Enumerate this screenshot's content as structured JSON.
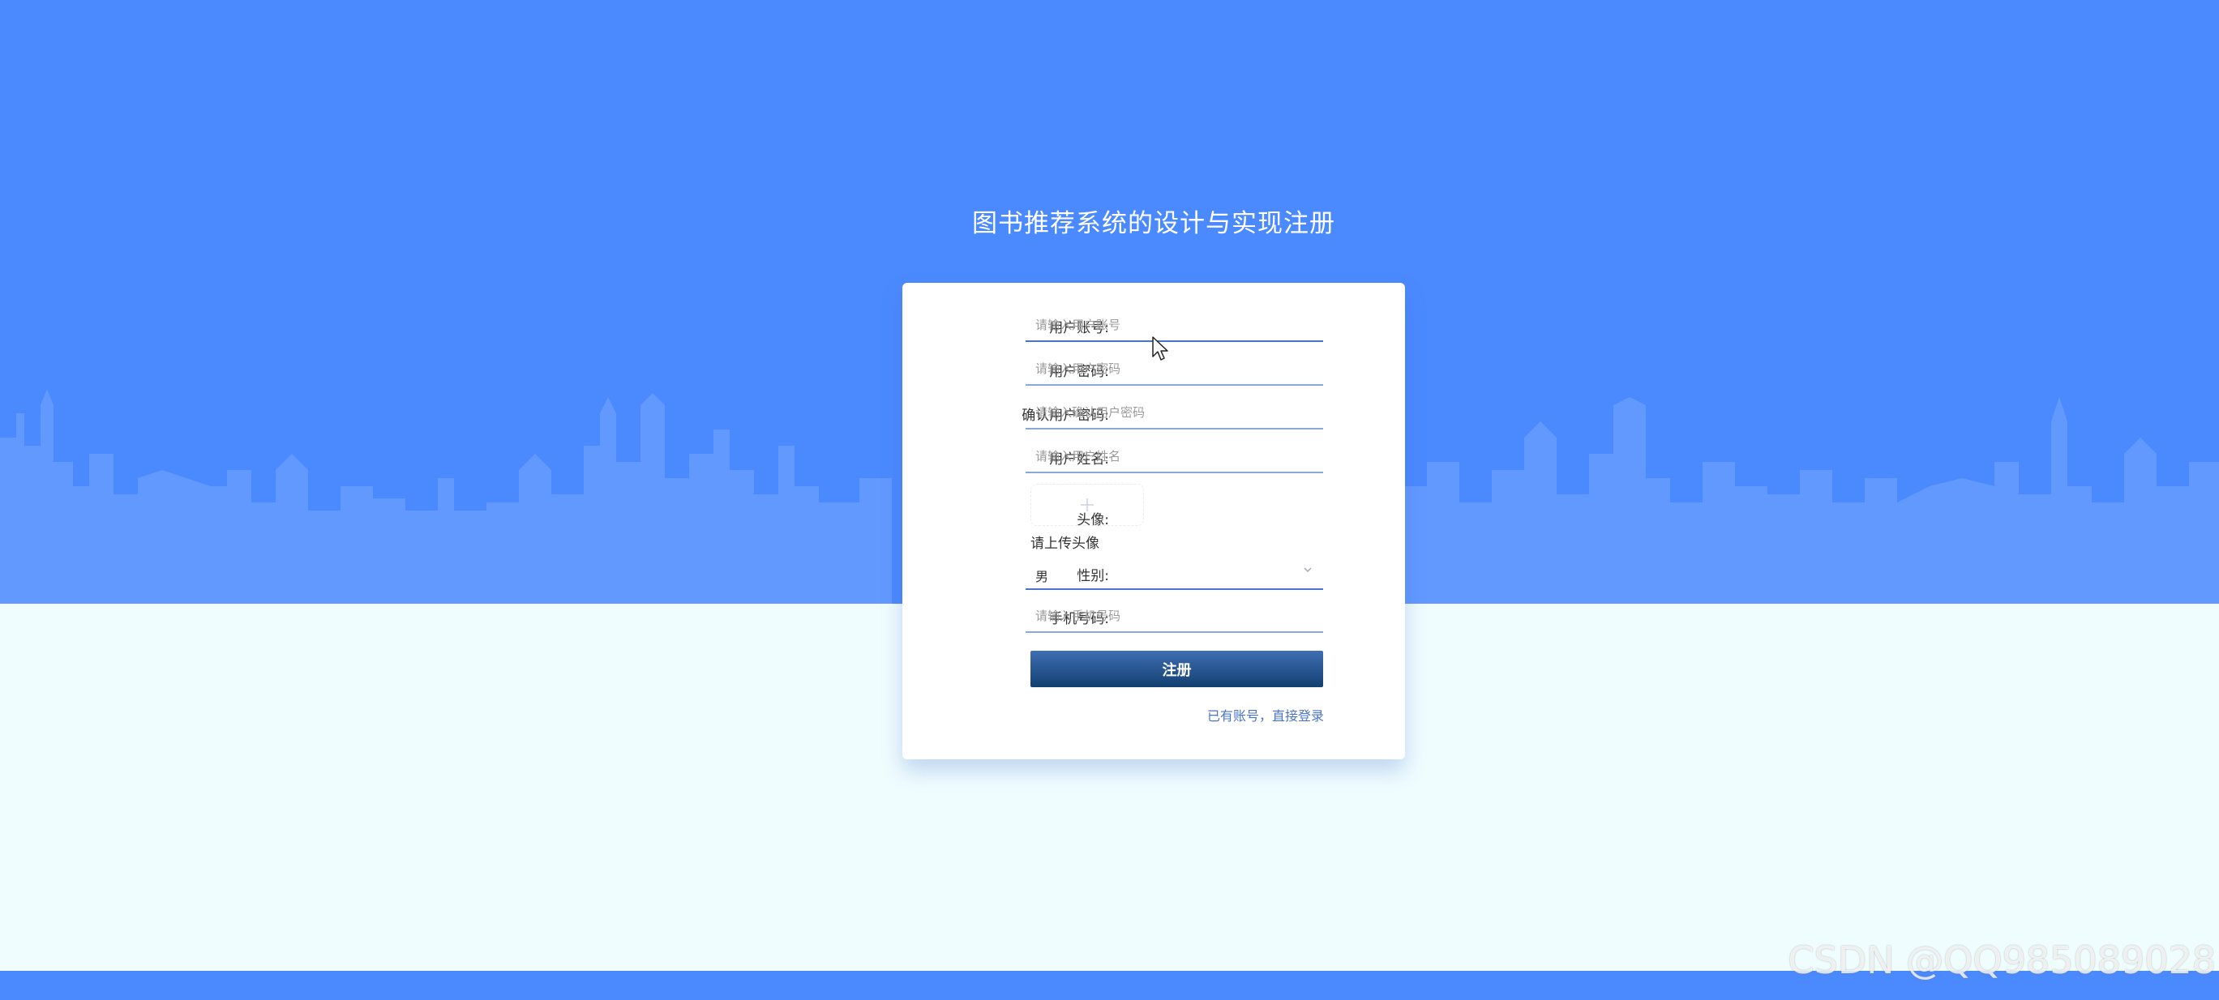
{
  "page": {
    "title": "图书推荐系统的设计与实现注册"
  },
  "form": {
    "account": {
      "label": "用户账号:",
      "placeholder": "请输入用户账号"
    },
    "password": {
      "label": "用户密码:",
      "placeholder": "请输入用户密码"
    },
    "confirm_password": {
      "label": "确认用户密码:",
      "placeholder": "请输入确认用户密码"
    },
    "name": {
      "label": "用户姓名:",
      "placeholder": "请输入用户姓名"
    },
    "avatar": {
      "label": "头像:",
      "hint": "请上传头像"
    },
    "gender": {
      "label": "性别:",
      "value": "男"
    },
    "phone": {
      "label": "手机号码:",
      "placeholder": "请输入手机号码"
    },
    "submit_label": "注册",
    "login_link": "已有账号，直接登录"
  },
  "watermark": "CSDN @QQ985089028",
  "colors": {
    "background_top": "#4b89fe",
    "background_bottom": "#f0fdff",
    "button_top": "#3e6fb3",
    "button_bottom": "#133f70",
    "link": "#4a74c9"
  },
  "icons": {
    "upload": "plus-icon",
    "select": "chevron-down-icon",
    "cursor": "mouse-pointer-icon"
  }
}
